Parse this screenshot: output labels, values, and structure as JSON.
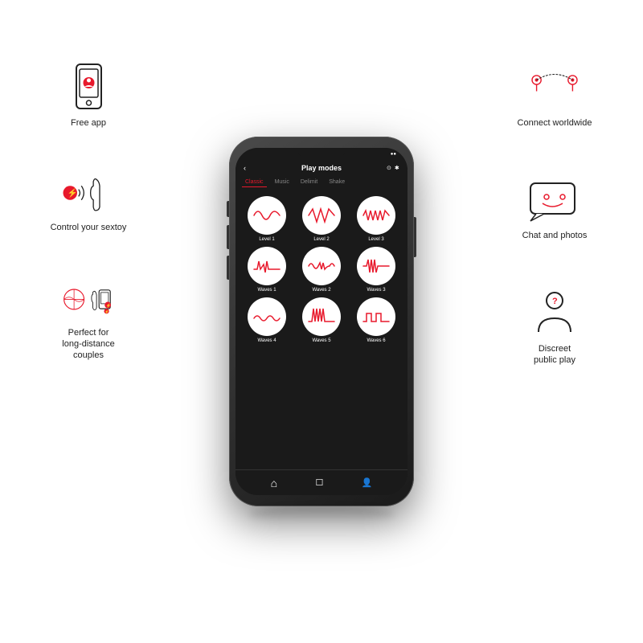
{
  "app": {
    "header": {
      "title": "Play modes",
      "back_icon": "‹",
      "settings_icon": "⚙",
      "bluetooth_icon": "⚡"
    },
    "tabs": [
      {
        "label": "Classic",
        "active": true
      },
      {
        "label": "Music",
        "active": false
      },
      {
        "label": "Delimit",
        "active": false
      },
      {
        "label": "Shake",
        "active": false
      }
    ],
    "modes": [
      {
        "label": "Level 1",
        "wave": "smooth"
      },
      {
        "label": "Level 2",
        "wave": "zigzag"
      },
      {
        "label": "Level 3",
        "wave": "dense"
      },
      {
        "label": "Waves 1",
        "wave": "spike"
      },
      {
        "label": "Waves 2",
        "wave": "complex"
      },
      {
        "label": "Waves 3",
        "wave": "pulse"
      },
      {
        "label": "Waves 4",
        "wave": "low"
      },
      {
        "label": "Waves 5",
        "wave": "tall"
      },
      {
        "label": "Waves 6",
        "wave": "flat"
      }
    ],
    "nav": [
      "🏠",
      "💬",
      "👤"
    ]
  },
  "features": {
    "left": [
      {
        "label": "Free app"
      },
      {
        "label": "Control your sextoy"
      },
      {
        "label": "Perfect for\nlong-distance\ncouples"
      }
    ],
    "right": [
      {
        "label": "Connect worldwide"
      },
      {
        "label": "Chat and photos"
      },
      {
        "label": "Discreet\npublic play"
      }
    ]
  },
  "colors": {
    "accent": "#e8192c",
    "bg": "#ffffff",
    "phone": "#1a1a1a"
  }
}
